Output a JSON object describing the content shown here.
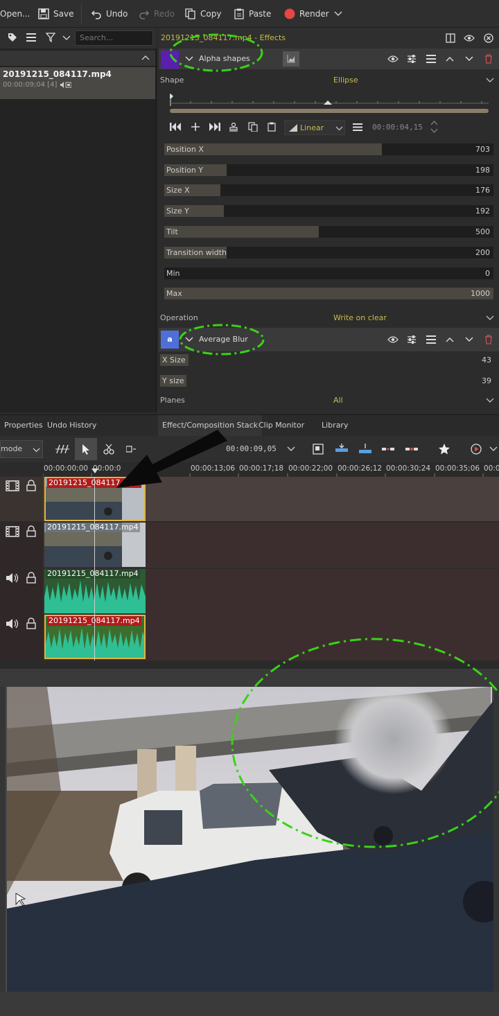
{
  "toolbar": {
    "open_label": "Open...",
    "save_label": "Save",
    "undo_label": "Undo",
    "redo_label": "Redo",
    "copy_label": "Copy",
    "paste_label": "Paste",
    "render_label": "Render",
    "render_color": "#e84545"
  },
  "bin": {
    "search_placeholder": "Search...",
    "clip_name": "20191215_084117.mp4",
    "clip_meta": "00:00:09;04 [4]"
  },
  "effects": {
    "title": "20191215_084117.mp4 - Effects",
    "alpha": {
      "name": "Alpha shapes",
      "badge_color": "#5a1fb0",
      "shape_label": "Shape",
      "shape_value": "Ellipse",
      "interp_value": "Linear",
      "timecode": "00:00:04,15",
      "params": [
        {
          "label": "Position X",
          "value": "703",
          "fill": 0.66
        },
        {
          "label": "Position Y",
          "value": "198",
          "fill": 0.19
        },
        {
          "label": "Size X",
          "value": "176",
          "fill": 0.17
        },
        {
          "label": "Size Y",
          "value": "192",
          "fill": 0.18
        },
        {
          "label": "Tilt",
          "value": "500",
          "fill": 0.47
        },
        {
          "label": "Transition width",
          "value": "200",
          "fill": 0.19
        },
        {
          "label": "Min",
          "value": "0",
          "fill": 0.0
        },
        {
          "label": "Max",
          "value": "1000",
          "fill": 1.0
        }
      ],
      "operation_label": "Operation",
      "operation_value": "Write on clear"
    },
    "blur": {
      "name": "Average Blur",
      "badge_letter": "a",
      "badge_color": "#4f6fd8",
      "x_size_label": "X Size",
      "x_size_value": "43",
      "y_size_label": "Y size",
      "y_size_value": "39",
      "planes_label": "Planes",
      "planes_value": "All"
    }
  },
  "tabs": {
    "properties": "Properties",
    "undo_history": "Undo History",
    "effect_stack": "Effect/Composition Stack",
    "clip_monitor": "Clip Monitor",
    "library": "Library"
  },
  "timeline": {
    "mode_label": "mode",
    "timecode": "00:00:09,05",
    "ruler_ticks": [
      "00:00:00;00",
      "00:00:0",
      "00:00:13;06",
      "00:00:17;18",
      "00:00:22;00",
      "00:00:26;12",
      "00:00:30;24",
      "00:00:35;06",
      "00:0"
    ],
    "tracks": [
      {
        "type": "video",
        "clip": "20191215_084117.mp4"
      },
      {
        "type": "video",
        "clip": "20191215_084117.mp4"
      },
      {
        "type": "audio",
        "clip": "20191215_084117.mp4"
      },
      {
        "type": "audio",
        "clip": "20191215_084117.mp4"
      }
    ]
  }
}
